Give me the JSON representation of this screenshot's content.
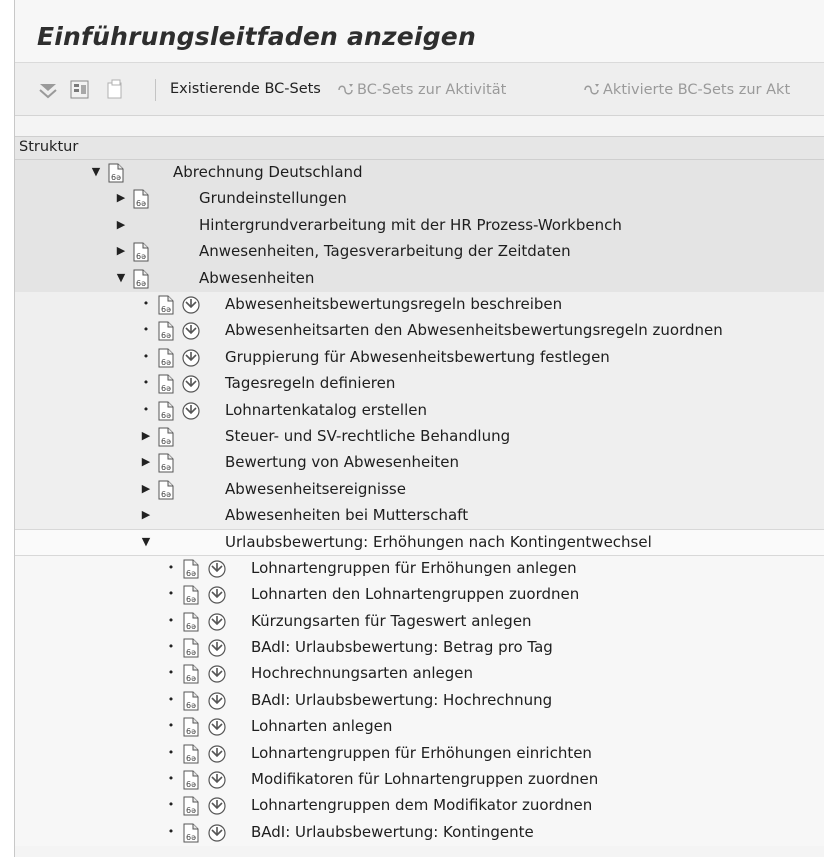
{
  "window": {
    "title": "Einführungsleitfaden anzeigen"
  },
  "toolbar": {
    "existing_bc_sets": "Existierende BC-Sets",
    "bc_sets_activity": "BC-Sets zur Aktivität",
    "activated_bc_sets": "Aktivierte BC-Sets zur Akt"
  },
  "tree": {
    "header": "Struktur",
    "items": {
      "abrechnung": "Abrechnung Deutschland",
      "grundeinstellungen": "Grundeinstellungen",
      "hintergrund": "Hintergrundverarbeitung mit der HR Prozess-Workbench",
      "anwesenheiten": "Anwesenheiten, Tagesverarbeitung der Zeitdaten",
      "abwesenheiten": "Abwesenheiten",
      "a1": "Abwesenheitsbewertungsregeln beschreiben",
      "a2": "Abwesenheitsarten den Abwesenheitsbewertungsregeln zuordnen",
      "a3": "Gruppierung für Abwesenheitsbewertung festlegen",
      "a4": "Tagesregeln definieren",
      "a5": "Lohnartenkatalog erstellen",
      "steuer": "Steuer- und SV-rechtliche Behandlung",
      "bewertung": "Bewertung von Abwesenheiten",
      "ereignisse": "Abwesenheitsereignisse",
      "mutterschaft": "Abwesenheiten bei Mutterschaft",
      "urlaub": "Urlaubsbewertung: Erhöhungen nach Kontingentwechsel",
      "u1": "Lohnartengruppen für Erhöhungen anlegen",
      "u2": "Lohnarten den Lohnartengruppen zuordnen",
      "u3": "Kürzungsarten für Tageswert anlegen",
      "u4": "BAdI: Urlaubsbewertung: Betrag pro Tag",
      "u5": "Hochrechnungsarten anlegen",
      "u6": "BAdI: Urlaubsbewertung: Hochrechnung",
      "u7": "Lohnarten anlegen",
      "u8": "Lohnartengruppen für Erhöhungen einrichten",
      "u9": "Modifikatoren für Lohnartengruppen zuordnen",
      "u10": "Lohnartengruppen dem Modifikator zuordnen",
      "u11": "BAdI: Urlaubsbewertung: Kontingente"
    }
  }
}
